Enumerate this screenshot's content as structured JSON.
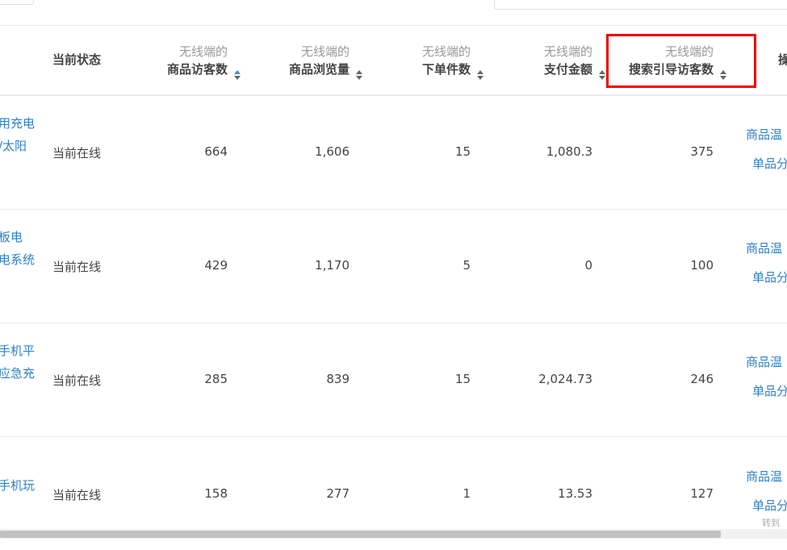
{
  "header": {
    "status": "当前状态",
    "prefix": "无线端的",
    "col1": "商品访客数",
    "col2": "商品浏览量",
    "col3": "下单件数",
    "col4": "支付金额",
    "col5": "搜索引导访客数",
    "op": "操"
  },
  "rows": [
    {
      "name1": "用充电",
      "name2": "/太阳",
      "status": "当前在线",
      "v1": "664",
      "v2": "1,606",
      "v3": "15",
      "v4": "1,080.3",
      "v5": "375",
      "op1": "商品温",
      "op2": "单品分"
    },
    {
      "name1": "板电",
      "name2": "电系统",
      "status": "当前在线",
      "v1": "429",
      "v2": "1,170",
      "v3": "5",
      "v4": "0",
      "v5": "100",
      "op1": "商品温",
      "op2": "单品分"
    },
    {
      "name1": "手机平",
      "name2": "应急充",
      "status": "当前在线",
      "v1": "285",
      "v2": "839",
      "v3": "15",
      "v4": "2,024.73",
      "v5": "246",
      "op1": "商品温",
      "op2": "单品分"
    },
    {
      "name1": "手机玩",
      "name2": "",
      "status": "当前在线",
      "v1": "158",
      "v2": "277",
      "v3": "1",
      "v4": "13.53",
      "v5": "127",
      "op1": "商品温",
      "op2": "单品分"
    }
  ],
  "float_tip": "转到"
}
